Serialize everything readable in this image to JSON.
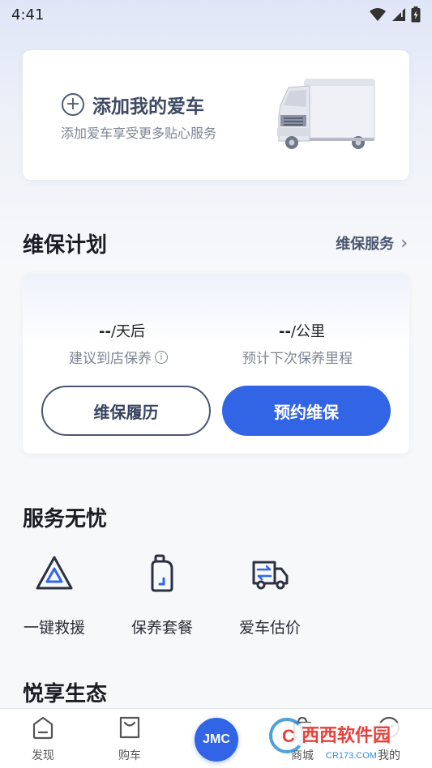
{
  "status_bar": {
    "time": "4:41"
  },
  "add_car": {
    "title": "添加我的爱车",
    "subtitle": "添加爱车享受更多贴心服务"
  },
  "maintenance": {
    "title": "维保计划",
    "link": "维保服务",
    "days_value": "--",
    "days_unit": "/天后",
    "days_label": "建议到店保养",
    "km_value": "--",
    "km_unit": "/公里",
    "km_label": "预计下次保养里程",
    "history_button": "维保履历",
    "book_button": "预约维保"
  },
  "services": {
    "title": "服务无忧",
    "items": [
      {
        "label": "一键救援",
        "icon": "warning-triangle-icon"
      },
      {
        "label": "保养套餐",
        "icon": "oil-bottle-icon"
      },
      {
        "label": "爱车估价",
        "icon": "exchange-truck-icon"
      }
    ]
  },
  "ecosystem": {
    "title": "悦享生态"
  },
  "tabbar": {
    "discover": "发现",
    "buy": "购车",
    "center": "JMC",
    "shop": "商城",
    "mine": "我的"
  },
  "watermark": {
    "text": "西西软件园",
    "sub": "CR173.COM"
  },
  "colors": {
    "primary": "#3165e6",
    "text_dark": "#1a1d24",
    "text_muted": "#7c8493"
  }
}
